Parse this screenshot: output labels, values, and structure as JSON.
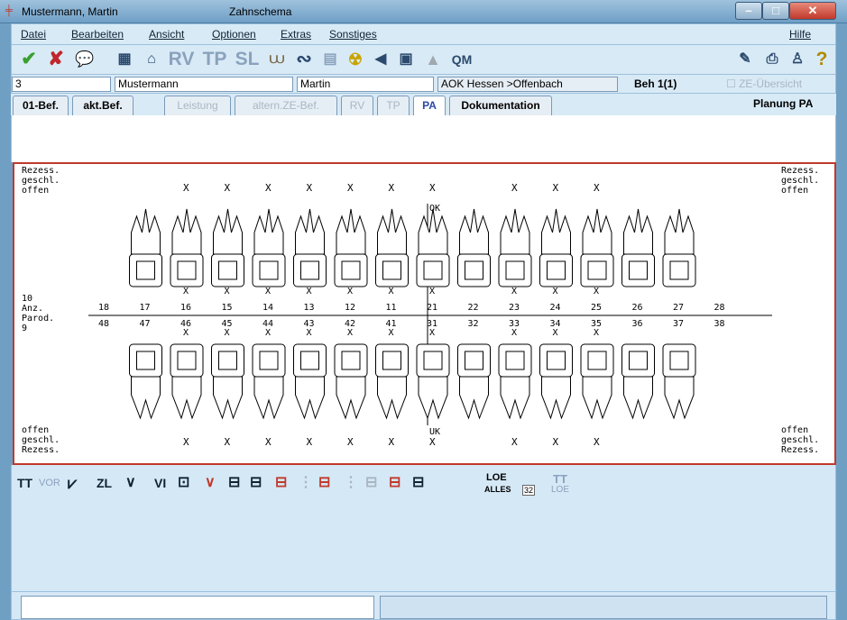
{
  "window": {
    "title": "Mustermann, Martin",
    "subtitle": "Zahnschema"
  },
  "menu": [
    {
      "label": "Datei"
    },
    {
      "label": "Bearbeiten"
    },
    {
      "label": "Ansicht"
    },
    {
      "label": "Optionen"
    },
    {
      "label": "Extras"
    },
    {
      "label": "Sonstiges"
    },
    {
      "label": "Hilfe"
    }
  ],
  "toolbar": {
    "text_buttons": [
      "RV",
      "TP",
      "SL"
    ]
  },
  "patient": {
    "id": "3",
    "lastname": "Mustermann",
    "firstname": "Martin",
    "insurance": "AOK Hessen >Offenbach",
    "treatment": "Beh 1(1)",
    "ze_overview": "ZE-Übersicht"
  },
  "tabs": [
    {
      "label": "01-Bef.",
      "enabled": true
    },
    {
      "label": "akt.Bef.",
      "enabled": true
    },
    {
      "label": "Leistung",
      "enabled": false
    },
    {
      "label": "altern.ZE-Bef.",
      "enabled": false
    },
    {
      "label": "RV",
      "enabled": false
    },
    {
      "label": "TP",
      "enabled": false
    },
    {
      "label": "PA",
      "enabled": true,
      "active": true
    },
    {
      "label": "Dokumentation",
      "enabled": true
    }
  ],
  "planning_label": "Planung PA",
  "chart_labels": {
    "rezess": "Rezess.",
    "geschl": "geschl.",
    "offen": "offen",
    "ok": "OK",
    "uk": "UK",
    "anz_value": "10",
    "anz": "Anz.",
    "parod": "Parod.",
    "parod_value": "9"
  },
  "upper_teeth": [
    "18",
    "17",
    "16",
    "15",
    "14",
    "13",
    "12",
    "11",
    "21",
    "22",
    "23",
    "24",
    "25",
    "26",
    "27",
    "28"
  ],
  "lower_teeth": [
    "48",
    "47",
    "46",
    "45",
    "44",
    "43",
    "42",
    "41",
    "31",
    "32",
    "33",
    "34",
    "35",
    "36",
    "37",
    "38"
  ],
  "upper_x_marks": [
    "16",
    "15",
    "14",
    "13",
    "12",
    "11",
    "21",
    "23",
    "24",
    "25"
  ],
  "lower_x_marks": [
    "46",
    "45",
    "44",
    "43",
    "42",
    "41",
    "31",
    "33",
    "34",
    "35"
  ],
  "bottom_tools": {
    "tt": "TT",
    "vor": "VOR",
    "zl": "ZL",
    "vi": "VI",
    "loe": "LOE",
    "alles": "ALLES",
    "count": "32",
    "tt_loe_1": "TT",
    "tt_loe_2": "LOE"
  }
}
